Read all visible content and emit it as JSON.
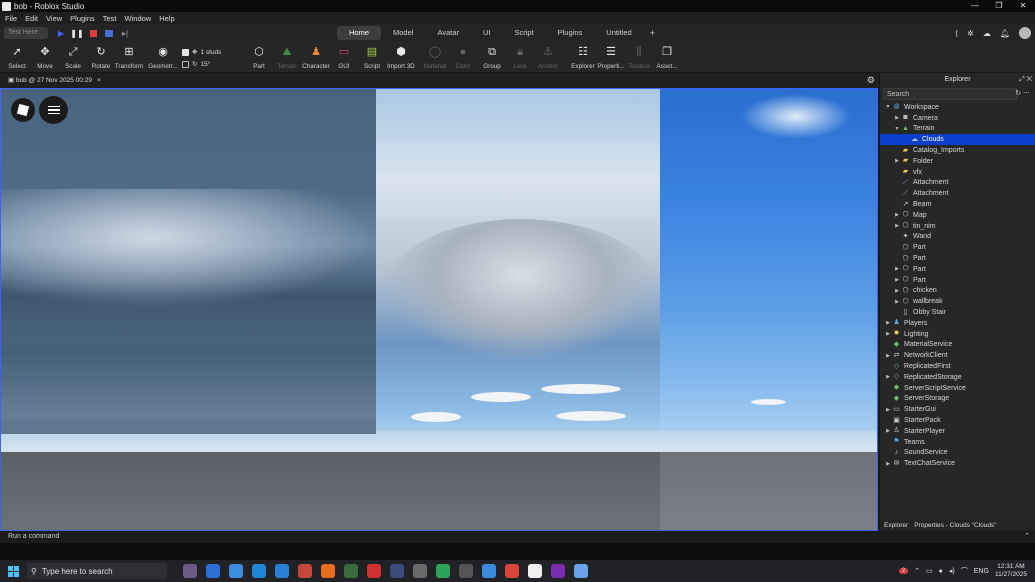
{
  "window": {
    "title": "bob - Roblox Studio",
    "controls": [
      "—",
      "❐",
      "✕"
    ]
  },
  "menu": [
    "File",
    "Edit",
    "View",
    "Plugins",
    "Test",
    "Window",
    "Help"
  ],
  "toolbar": {
    "test_mode": "Test Here",
    "tabs": [
      "Home",
      "Model",
      "Avatar",
      "UI",
      "Script",
      "Plugins",
      "Untitled"
    ],
    "active_tab": "Home"
  },
  "ribbon": {
    "select": "Select",
    "move": "Move",
    "scale": "Scale",
    "rotate": "Rotate",
    "transform": "Transform",
    "geometry": "Geometr...",
    "studs": "1 studs",
    "degrees": "15°",
    "part": "Part",
    "terrain": "Terrain",
    "character": "Character",
    "gui": "GUI",
    "script": "Script",
    "import3d": "Import 3D",
    "material": "Material",
    "color": "Color",
    "group": "Group",
    "lock": "Lock",
    "anchor": "Anchor",
    "explorer": "Explorer",
    "properties": "Properti...",
    "toolbox": "Toolbox",
    "assets": "Asset..."
  },
  "doc_tab": {
    "label": "bob @ 27 Nov 2025 00:29"
  },
  "explorer": {
    "title": "Explorer",
    "search_placeholder": "Search",
    "items": [
      {
        "label": "Workspace",
        "depth": 0,
        "expanded": true,
        "icon": "workspace-icon",
        "color": "#5aa8e6"
      },
      {
        "label": "Camera",
        "depth": 1,
        "arrow": true,
        "icon": "camera-icon",
        "color": "#cfcfcf"
      },
      {
        "label": "Terrain",
        "depth": 1,
        "expanded": true,
        "icon": "terrain-icon",
        "color": "#6cc06c"
      },
      {
        "label": "Clouds",
        "depth": 2,
        "icon": "clouds-icon",
        "color": "#a9d2ff",
        "selected": true
      },
      {
        "label": "Catalog_Imports",
        "depth": 1,
        "icon": "folder-icon",
        "color": "#e8c15a"
      },
      {
        "label": "Folder",
        "depth": 1,
        "arrow": true,
        "icon": "folder-icon",
        "color": "#e8c15a"
      },
      {
        "label": "vfx",
        "depth": 1,
        "icon": "folder-icon",
        "color": "#e8c15a"
      },
      {
        "label": "Attachment",
        "depth": 1,
        "icon": "attachment-icon",
        "color": "#7fb3ff"
      },
      {
        "label": "Attachment",
        "depth": 1,
        "icon": "attachment-icon",
        "color": "#7fb3ff"
      },
      {
        "label": "Beam",
        "depth": 1,
        "icon": "beam-icon",
        "color": "#cfcfcf"
      },
      {
        "label": "Map",
        "depth": 1,
        "arrow": true,
        "icon": "model-icon",
        "color": "#cfcfcf"
      },
      {
        "label": "tin_nim",
        "depth": 1,
        "arrow": true,
        "icon": "model-icon",
        "color": "#cfcfcf"
      },
      {
        "label": "Wand",
        "depth": 1,
        "icon": "tool-icon",
        "color": "#cfcfcf"
      },
      {
        "label": "Part",
        "depth": 1,
        "icon": "part-icon",
        "color": "#cfcfcf"
      },
      {
        "label": "Part",
        "depth": 1,
        "icon": "part-icon",
        "color": "#cfcfcf"
      },
      {
        "label": "Part",
        "depth": 1,
        "arrow": true,
        "icon": "part-icon",
        "color": "#cfcfcf"
      },
      {
        "label": "Part",
        "depth": 1,
        "arrow": true,
        "icon": "part-icon",
        "color": "#cfcfcf"
      },
      {
        "label": "chicken",
        "depth": 1,
        "arrow": true,
        "icon": "model-icon",
        "color": "#cfcfcf"
      },
      {
        "label": "wallbreak",
        "depth": 1,
        "arrow": true,
        "icon": "model-icon",
        "color": "#cfcfcf"
      },
      {
        "label": "Obby Stair",
        "depth": 1,
        "icon": "truss-icon",
        "color": "#cfcfcf"
      },
      {
        "label": "Players",
        "depth": 0,
        "arrow": true,
        "icon": "players-icon",
        "color": "#5aa8e6"
      },
      {
        "label": "Lighting",
        "depth": 0,
        "arrow": true,
        "icon": "lighting-icon",
        "color": "#f2d14b"
      },
      {
        "label": "MaterialService",
        "depth": 0,
        "icon": "material-service-icon",
        "color": "#6cc06c"
      },
      {
        "label": "NetworkClient",
        "depth": 0,
        "arrow": true,
        "icon": "network-icon",
        "color": "#cfcfcf"
      },
      {
        "label": "ReplicatedFirst",
        "depth": 0,
        "icon": "replicated-first-icon",
        "color": "#6cc06c"
      },
      {
        "label": "ReplicatedStorage",
        "depth": 0,
        "arrow": true,
        "icon": "replicated-storage-icon",
        "color": "#6cc06c"
      },
      {
        "label": "ServerScriptService",
        "depth": 0,
        "icon": "server-script-icon",
        "color": "#6cc06c"
      },
      {
        "label": "ServerStorage",
        "depth": 0,
        "icon": "server-storage-icon",
        "color": "#6cc06c"
      },
      {
        "label": "StarterGui",
        "depth": 0,
        "arrow": true,
        "icon": "starter-gui-icon",
        "color": "#cfcfcf"
      },
      {
        "label": "StarterPack",
        "depth": 0,
        "icon": "starter-pack-icon",
        "color": "#cfcfcf"
      },
      {
        "label": "StarterPlayer",
        "depth": 0,
        "arrow": true,
        "icon": "starter-player-icon",
        "color": "#cfcfcf"
      },
      {
        "label": "Teams",
        "depth": 0,
        "icon": "teams-icon",
        "color": "#5aa8e6"
      },
      {
        "label": "SoundService",
        "depth": 0,
        "icon": "sound-icon",
        "color": "#cfcfcf"
      },
      {
        "label": "TextChatService",
        "depth": 0,
        "arrow": true,
        "icon": "chat-icon",
        "color": "#cfcfcf"
      }
    ],
    "footer_tabs": [
      "Explorer",
      "Properties - Clouds \"Clouds\""
    ]
  },
  "command_bar": {
    "placeholder": "Run a command"
  },
  "taskbar": {
    "search": "Type here to search",
    "language": "ENG",
    "time": "12:31 AM",
    "date": "11/27/2025",
    "notification_count": "2"
  },
  "colors": {
    "accent": "#3b63ff",
    "selection": "#0b3ec9"
  }
}
